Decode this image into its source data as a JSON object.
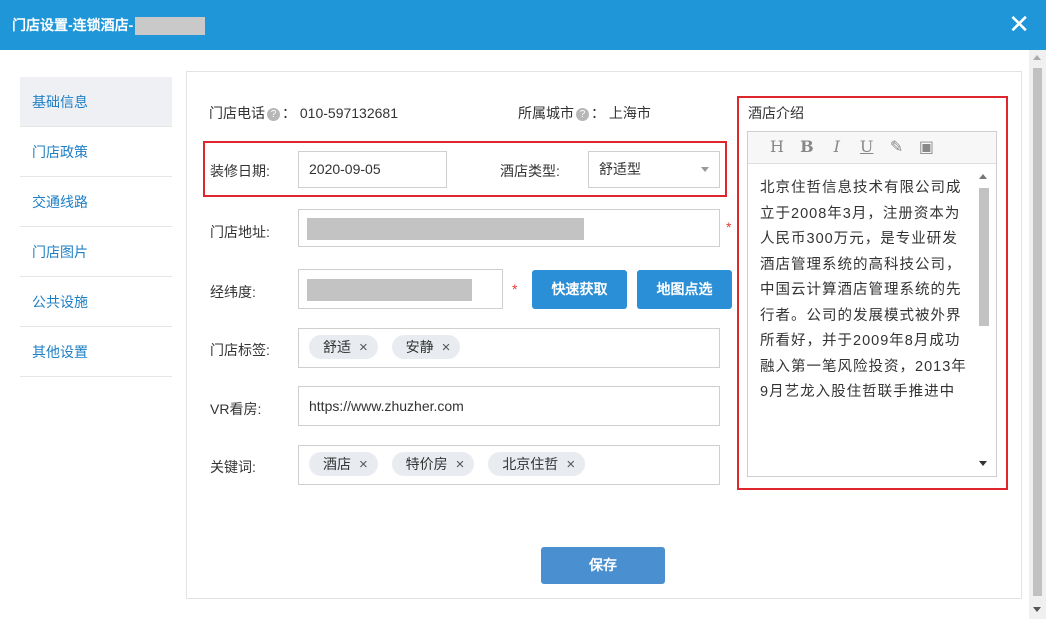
{
  "title": {
    "text": "门店设置-连锁酒店-",
    "close_glyph": "✕"
  },
  "sidebar": {
    "items": [
      {
        "label": "基础信息",
        "active": true
      },
      {
        "label": "门店政策"
      },
      {
        "label": "交通线路"
      },
      {
        "label": "门店图片"
      },
      {
        "label": "公共设施"
      },
      {
        "label": "其他设置"
      }
    ]
  },
  "form": {
    "phone_label": "门店电话",
    "phone_value": "010-597132681",
    "city_label": "所属城市",
    "city_value": "上海市",
    "help_glyph": "?",
    "colon": "：",
    "renovation_label": "装修日期:",
    "renovation_value": "2020-09-05",
    "hotel_type_label": "酒店类型:",
    "hotel_type_value": "舒适型",
    "address_label": "门店地址:",
    "coords_label": "经纬度:",
    "required_mark": "*",
    "quick_get_button": "快速获取",
    "map_pick_button": "地图点选",
    "tags_label": "门店标签:",
    "tags": [
      "舒适",
      "安静"
    ],
    "vr_label": "VR看房:",
    "vr_value": "https://www.zhuzher.com",
    "keywords_label": "关键词:",
    "keywords": [
      "酒店",
      "特价房",
      "北京住哲"
    ],
    "remove_glyph": "×",
    "save_button": "保存"
  },
  "intro": {
    "label": "酒店介绍",
    "toolbar": [
      "H",
      "B",
      "I",
      "U",
      "✎",
      "▣"
    ],
    "text": "北京住哲信息技术有限公司成立于2008年3月，注册资本为人民币300万元，是专业研发酒店管理系统的高科技公司，中国云计算酒店管理系统的先行者。公司的发展模式被外界所看好，并于2009年8月成功融入第一笔风险投资，2013年9月艺龙入股住哲联手推进中"
  },
  "colors": {
    "titlebar": "#1e96d8",
    "link": "#1e7fc5",
    "button": "#2a8fd6",
    "highlight": "#e0262d"
  }
}
